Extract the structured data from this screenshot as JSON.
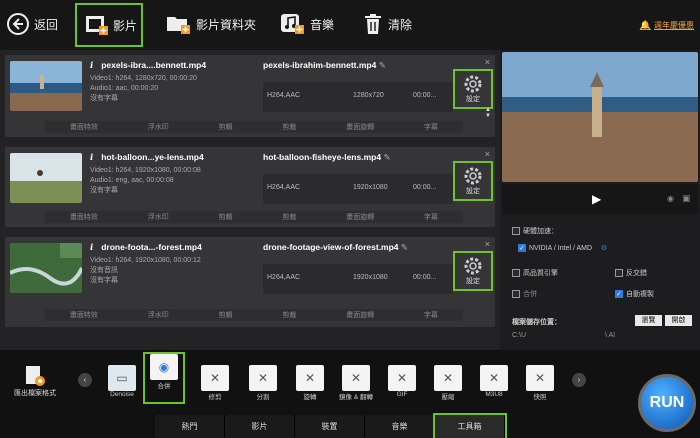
{
  "toolbar": {
    "back": "返回",
    "video": "影片",
    "folder": "影片資料夾",
    "music": "音樂",
    "clear": "清除",
    "promo": "週年慶優惠"
  },
  "files": [
    {
      "name": "pexels-ibra....bennett.mp4",
      "video": "Video1: h264, 1280x720, 00:00:20",
      "audio": "Audio1: aac, 00:00:20",
      "sub": "沒有字幕",
      "out_name": "pexels-ibrahim-bennett.mp4",
      "codec": "H264,AAC",
      "res": "1280x720",
      "dur": "00:00...",
      "settings": "設定"
    },
    {
      "name": "hot-balloon...ye-lens.mp4",
      "video": "Video1: h264, 1920x1080, 00:00:08",
      "audio": "Audio1: eng, aac, 00:00:08",
      "sub": "沒有字幕",
      "out_name": "hot-balloon-fisheye-lens.mp4",
      "codec": "H264,AAC",
      "res": "1920x1080",
      "dur": "00:00...",
      "settings": "設定"
    },
    {
      "name": "drone-foota...-forest.mp4",
      "video": "Video1: h264, 1920x1080, 00:00:12",
      "audio": "沒有音訊",
      "sub": "沒有字幕",
      "out_name": "drone-footage-view-of-forest.mp4",
      "codec": "H264,AAC",
      "res": "1920x1080",
      "dur": "00:00...",
      "settings": "設定"
    }
  ],
  "tools": [
    "畫面特效",
    "浮水印",
    "剪輯",
    "剪裁",
    "畫面旋轉",
    "字幕"
  ],
  "side": {
    "hw_label": "硬體加速：",
    "gpu": "NVIDIA / Intel / AMD",
    "hq": "高品質引擎",
    "deinterlace": "反交錯",
    "merge": "合併",
    "autocopy": "自動複製",
    "save_label": "檔案儲存位置：",
    "path": "C:\\U",
    "path_tail": "\\ AI",
    "browse": "瀏覽",
    "open": "開啟"
  },
  "formats": {
    "title": "匯出檔案格式",
    "items": [
      "Denoise",
      "合併",
      "修剪",
      "分割",
      "旋轉",
      "鏡像 & 翻轉",
      "GIF",
      "壓縮",
      "M3U8",
      "快照"
    ]
  },
  "tabs": [
    "熱門",
    "影片",
    "裝置",
    "音樂",
    "工具箱"
  ],
  "run": "RUN"
}
